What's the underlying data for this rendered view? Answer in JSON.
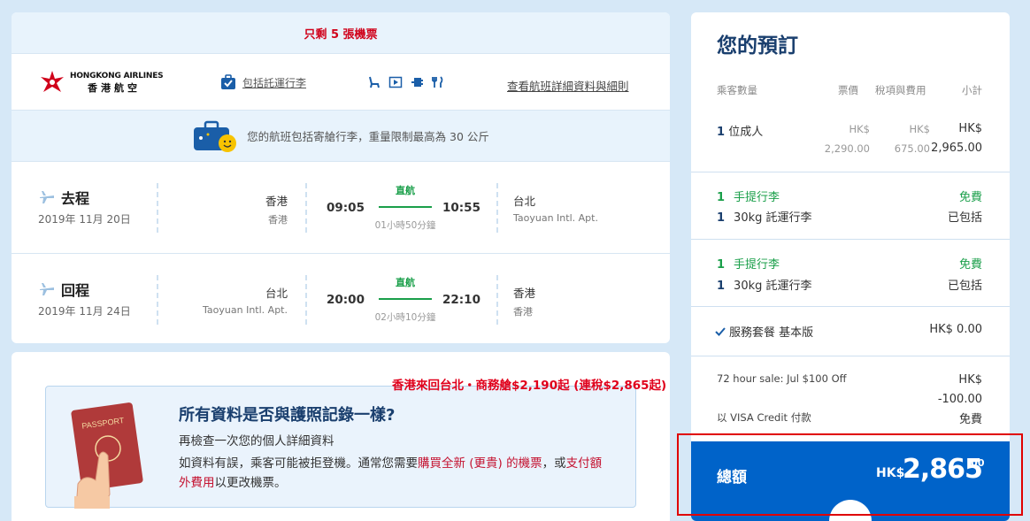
{
  "flight": {
    "seats_left": "只剩 5 張機票",
    "airline": {
      "name_en": "HONGKONG AIRLINES",
      "name_zh": "香港航空"
    },
    "baggage_link": "包括託運行李",
    "amenity_icons": [
      "seat-icon",
      "video-icon",
      "power-icon",
      "meal-icon"
    ],
    "details_link": "查看航班詳細資料與細則",
    "baggage_note": "您的航班包括寄艙行李，重量限制最高為 30 公斤",
    "legs": [
      {
        "type": "去程",
        "date": "2019年 11月 20日",
        "from_city": "香港",
        "from_airport": "香港",
        "depart": "09:05",
        "stops": "直航",
        "duration": "01小時50分鐘",
        "arrive": "10:55",
        "to_city": "台北",
        "to_airport": "Taoyuan Intl. Apt."
      },
      {
        "type": "回程",
        "date": "2019年 11月 24日",
        "from_city": "台北",
        "from_airport": "Taoyuan Intl. Apt.",
        "depart": "20:00",
        "stops": "直航",
        "duration": "02小時10分鐘",
        "arrive": "22:10",
        "to_city": "香港",
        "to_airport": "香港"
      }
    ]
  },
  "passport": {
    "title": "所有資料是否與護照記錄一樣?",
    "subtitle": "再檢查一次您的個人詳細資料",
    "body_1": "如資料有誤，乘客可能被拒登機。通常您需要",
    "link_1": "購買全新 (更貴) 的機票",
    "body_2": "，或",
    "link_2": "支付額外費用",
    "body_3": "以更改機票。"
  },
  "promo": "香港來回台北・商務艙$2,190起 (連稅$2,865起)",
  "summary": {
    "title": "您的預訂",
    "headers": {
      "pax": "乘客數量",
      "fare": "票價",
      "tax": "稅項與費用",
      "subtotal": "小計"
    },
    "pax": {
      "count": "1",
      "label": "位成人"
    },
    "fare": {
      "cur": "HK$",
      "amt": "2,290.00"
    },
    "tax": {
      "cur": "HK$",
      "amt": "675.00"
    },
    "subtotal": {
      "cur": "HK$",
      "amt": "2,965.00"
    },
    "bags": [
      {
        "carry_count": "1",
        "carry_label": "手提行李",
        "carry_val": "免費",
        "check_count": "1",
        "check_label": "30kg 託運行李",
        "check_val": "已包括"
      },
      {
        "carry_count": "1",
        "carry_label": "手提行李",
        "carry_val": "免費",
        "check_count": "1",
        "check_label": "30kg 託運行李",
        "check_val": "已包括"
      }
    ],
    "service": {
      "label": "服務套餐 基本版",
      "value": "HK$ 0.00"
    },
    "sale": {
      "label": "72 hour sale: Jul $100 Off",
      "cur": "HK$",
      "amt": "-100.00"
    },
    "payment": {
      "label": "以 VISA Credit 付款",
      "value": "免費"
    },
    "total": {
      "label": "總額",
      "cur": "HK$",
      "amount": "2,865",
      "decimals": ".00"
    }
  },
  "colors": {
    "brand": "#1a3f6e",
    "accent": "#0063c9",
    "green": "#1a9f4a",
    "red": "#d0021b"
  }
}
